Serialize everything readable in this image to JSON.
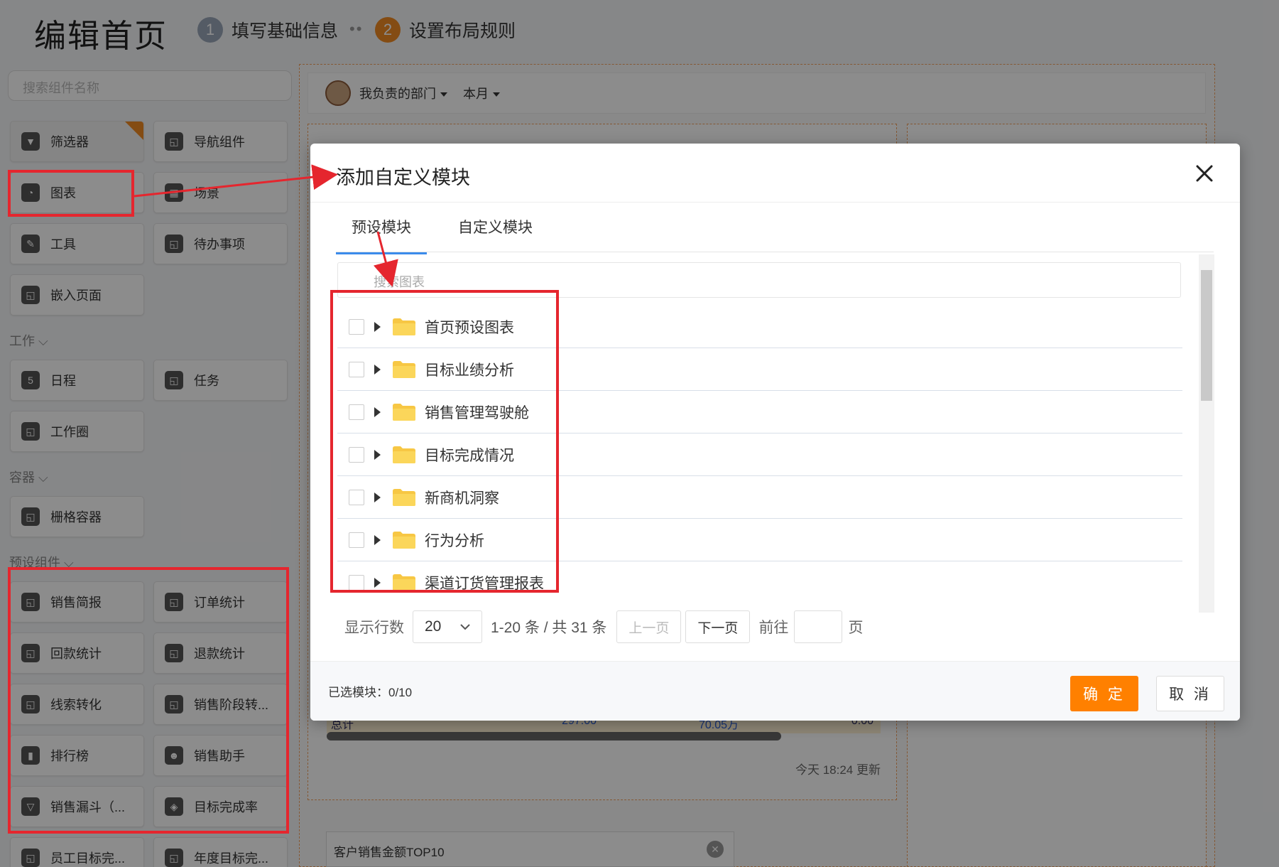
{
  "editor": {
    "title": "编辑首页",
    "steps": [
      {
        "num": "1",
        "label": "填写基础信息",
        "color": "#9aa6b8"
      },
      {
        "num": "2",
        "label": "设置布局规则",
        "color": "#f08a24"
      }
    ],
    "step_separator": "••",
    "search_placeholder": "搜索组件名称"
  },
  "components": {
    "basic": [
      {
        "label": "筛选器",
        "icon": "filter-icon",
        "glyph": "▼"
      },
      {
        "label": "导航组件",
        "icon": "component-icon",
        "glyph": "◱"
      },
      {
        "label": "图表",
        "icon": "chart-pie-icon",
        "glyph": "◔"
      },
      {
        "label": "场景",
        "icon": "scene-grid-icon",
        "glyph": "▦"
      },
      {
        "label": "工具",
        "icon": "wrench-icon",
        "glyph": "✎"
      },
      {
        "label": "待办事项",
        "icon": "component-icon",
        "glyph": "◱"
      },
      {
        "label": "嵌入页面",
        "icon": "component-icon",
        "glyph": "◱"
      }
    ],
    "work_label": "工作",
    "work": [
      {
        "label": "日程",
        "icon": "calendar-icon",
        "glyph": "5"
      },
      {
        "label": "任务",
        "icon": "component-icon",
        "glyph": "◱"
      },
      {
        "label": "工作圈",
        "icon": "component-icon",
        "glyph": "◱"
      }
    ],
    "container_label": "容器",
    "container": [
      {
        "label": "栅格容器",
        "icon": "component-icon",
        "glyph": "◱"
      }
    ],
    "preset_label": "预设组件",
    "preset": [
      {
        "label": "销售简报",
        "icon": "component-icon",
        "glyph": "◱"
      },
      {
        "label": "订单统计",
        "icon": "component-icon",
        "glyph": "◱"
      },
      {
        "label": "回款统计",
        "icon": "component-icon",
        "glyph": "◱"
      },
      {
        "label": "退款统计",
        "icon": "component-icon",
        "glyph": "◱"
      },
      {
        "label": "线索转化",
        "icon": "component-icon",
        "glyph": "◱"
      },
      {
        "label": "销售阶段转...",
        "icon": "component-icon",
        "glyph": "◱"
      },
      {
        "label": "排行榜",
        "icon": "bar-chart-icon",
        "glyph": "▮"
      },
      {
        "label": "销售助手",
        "icon": "assistant-icon",
        "glyph": "☻"
      },
      {
        "label": "销售漏斗（...",
        "icon": "funnel-icon",
        "glyph": "▽"
      },
      {
        "label": "目标完成率",
        "icon": "target-icon",
        "glyph": "◈"
      },
      {
        "label": "员工目标完...",
        "icon": "component-icon",
        "glyph": "◱"
      },
      {
        "label": "年度目标完...",
        "icon": "component-icon",
        "glyph": "◱"
      }
    ]
  },
  "canvas": {
    "dept_filter": "我负责的部门",
    "period_filter": "本月",
    "table_total": {
      "label": "总计",
      "v1": "297.00",
      "v2": "70.05万",
      "v3": "0.00"
    },
    "updated": "今天 18:24 更新",
    "top10_title": "客户销售金额TOP10"
  },
  "dialog": {
    "title": "添加自定义模块",
    "tabs": [
      "预设模块",
      "自定义模块"
    ],
    "search_placeholder": "搜索图表",
    "folders": [
      "首页预设图表",
      "目标业绩分析",
      "销售管理驾驶舱",
      "目标完成情况",
      "新商机洞察",
      "行为分析",
      "渠道订货管理报表"
    ],
    "pager": {
      "rows_label": "显示行数",
      "rows_value": "20",
      "range": "1-20 条 / 共 31 条",
      "prev": "上一页",
      "next": "下一页",
      "goto": "前往",
      "page_unit": "页"
    },
    "selected": "已选模块：0/10",
    "ok": "确 定",
    "cancel": "取 消"
  },
  "colors": {
    "accent": "#ff8000",
    "tab_active": "#3b8beb",
    "highlight": "#e5262e",
    "folder": "#f7c744"
  }
}
